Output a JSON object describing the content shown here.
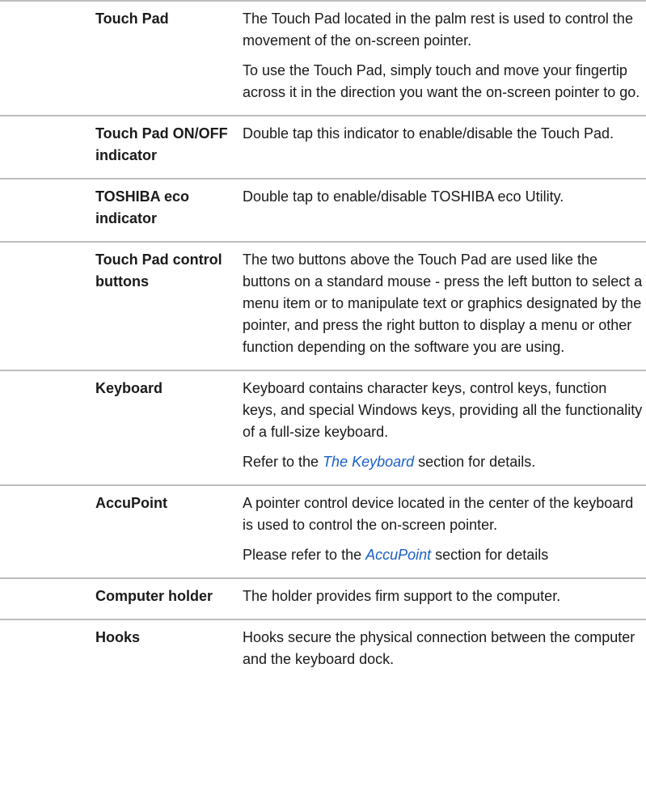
{
  "rows": [
    {
      "term": "Touch Pad",
      "paragraphs": [
        "The Touch Pad located in the palm rest is used to control the movement of the on-screen pointer.",
        "To use the Touch Pad, simply touch and move your fingertip across it in the direction you want the on-screen pointer to go."
      ]
    },
    {
      "term": "Touch Pad ON/OFF indicator",
      "paragraphs": [
        "Double tap this indicator to enable/disable the Touch Pad."
      ]
    },
    {
      "term": "TOSHIBA eco indicator",
      "paragraphs": [
        "Double tap to enable/disable TOSHIBA eco Utility."
      ]
    },
    {
      "term": "Touch Pad control buttons",
      "paragraphs": [
        "The two buttons above the Touch Pad are used like the buttons on a standard mouse - press the left button to select a menu item or to manipulate text or graphics designated by the pointer, and press the right button to display a menu or other function depending on the software you are using."
      ]
    },
    {
      "term": "Keyboard",
      "paragraphs": [
        "Keyboard contains character keys, control keys, function keys, and special Windows keys, providing all the functionality of a full-size keyboard."
      ],
      "ref": {
        "before": "Refer to the ",
        "link": "The Keyboard",
        "after": " section for details."
      }
    },
    {
      "term": "AccuPoint",
      "paragraphs": [
        "A pointer control device located in the center of the keyboard is used to control the on-screen pointer."
      ],
      "ref": {
        "before": "Please refer to the ",
        "link": "AccuPoint",
        "after": " section for details"
      }
    },
    {
      "term": "Computer holder",
      "paragraphs": [
        "The holder provides firm support to the computer."
      ]
    },
    {
      "term": "Hooks",
      "paragraphs": [
        "Hooks secure the physical connection between the computer and the keyboard dock."
      ]
    }
  ]
}
